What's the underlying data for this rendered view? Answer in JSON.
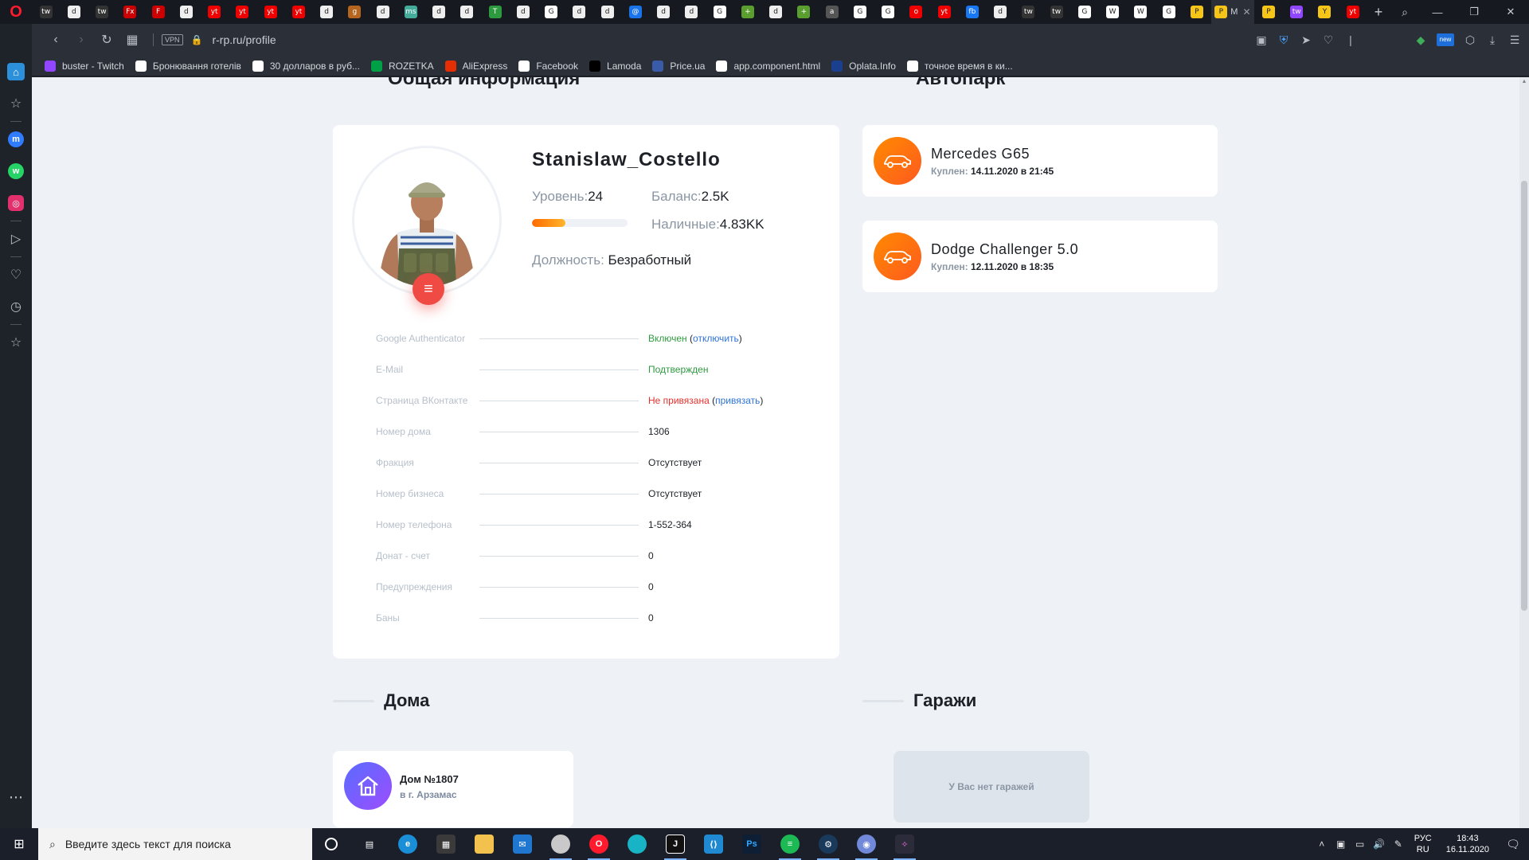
{
  "browser": {
    "url": "r-rp.ru/profile",
    "vpn_label": "VPN",
    "active_tab_title": "M",
    "tab_favicons": [
      "tw",
      "d",
      "tw",
      "Fx",
      "F",
      "d",
      "yt",
      "yt",
      "yt",
      "yt",
      "d",
      "g",
      "d",
      "ms",
      "d",
      "d",
      "T",
      "d",
      "G",
      "d",
      "d",
      "@",
      "d",
      "d",
      "G",
      "+",
      "d",
      "+",
      "a",
      "G",
      "G",
      "o",
      "yt",
      "fb",
      "d",
      "tw",
      "tw",
      "G",
      "W",
      "W",
      "G",
      "P",
      "P",
      "tw",
      "Y",
      "yt"
    ]
  },
  "bookmarks": [
    {
      "label": "buster - Twitch",
      "icon": "twitch-icon",
      "color": "#9146ff"
    },
    {
      "label": "Бронювання готелів",
      "icon": "page-icon",
      "color": "#ffffff"
    },
    {
      "label": "30 долларов в руб...",
      "icon": "google-icon",
      "color": "#ffffff"
    },
    {
      "label": "ROZETKA",
      "icon": "rozetka-icon",
      "color": "#00a046"
    },
    {
      "label": "AliExpress",
      "icon": "aliexpress-icon",
      "color": "#e62e04"
    },
    {
      "label": "Facebook",
      "icon": "page-icon",
      "color": "#ffffff"
    },
    {
      "label": "Lamoda",
      "icon": "lamoda-icon",
      "color": "#000000"
    },
    {
      "label": "Price.ua",
      "icon": "price-icon",
      "color": "#3a5ca8"
    },
    {
      "label": "app.component.html",
      "icon": "page-icon",
      "color": "#ffffff"
    },
    {
      "label": "Oplata.Info",
      "icon": "oplata-icon",
      "color": "#1b3f8f"
    },
    {
      "label": "точное время в ки...",
      "icon": "google-icon",
      "color": "#ffffff"
    }
  ],
  "sections": {
    "social_title": "Общая информация",
    "cars_title": "Автопарк",
    "houses_title": "Дома",
    "garages_title": "Гаражи"
  },
  "profile": {
    "name": "Stanislaw_Costello",
    "level_label": "Уровень:",
    "level": "24",
    "level_progress": 0.35,
    "balance_label": "Баланс:",
    "balance": "2.5K",
    "cash_label": "Наличные:",
    "cash": "4.83KK",
    "position_label": "Должность:",
    "position": "Безработный"
  },
  "info": [
    {
      "label": "Google Authenticator",
      "value": "Включен",
      "value_class": "green",
      "link": "отключить"
    },
    {
      "label": "E-Mail",
      "value": "Подтвержден",
      "value_class": "green",
      "link": ""
    },
    {
      "label": "Страница ВКонтакте",
      "value": "Не привязана",
      "value_class": "red",
      "link": "привязать"
    },
    {
      "label": "Номер дома",
      "value": "1306",
      "value_class": "",
      "link": ""
    },
    {
      "label": "Фракция",
      "value": "Отсутствует",
      "value_class": "",
      "link": ""
    },
    {
      "label": "Номер бизнеса",
      "value": "Отсутствует",
      "value_class": "",
      "link": ""
    },
    {
      "label": "Номер телефона",
      "value": "1-552-364",
      "value_class": "",
      "link": ""
    },
    {
      "label": "Донат - счет",
      "value": "0",
      "value_class": "",
      "link": ""
    },
    {
      "label": "Предупреждения",
      "value": "0",
      "value_class": "",
      "link": ""
    },
    {
      "label": "Баны",
      "value": "0",
      "value_class": "",
      "link": ""
    }
  ],
  "cars": [
    {
      "name": "Mercedes G65",
      "bought_label": "Куплен:",
      "bought": "14.11.2020 в 21:45"
    },
    {
      "name": "Dodge Challenger 5.0",
      "bought_label": "Куплен:",
      "bought": "12.11.2020 в 18:35"
    }
  ],
  "houses": [
    {
      "name": "Дом №1807",
      "city": "в г. Арзамас"
    }
  ],
  "garages_empty": "У Вас нет гаражей",
  "taskbar": {
    "search_placeholder": "Введите здесь текст для поиска",
    "lang_top": "РУС",
    "lang_bottom": "RU",
    "time": "18:43",
    "date": "16.11.2020"
  },
  "colors": {
    "accent_orange": "#ff7a00",
    "menu_red": "#f04a45",
    "house_purple": "#7a5cff",
    "ok_green": "#2e9a3f",
    "warn_red": "#e5312d",
    "link_blue": "#2e74d8"
  }
}
